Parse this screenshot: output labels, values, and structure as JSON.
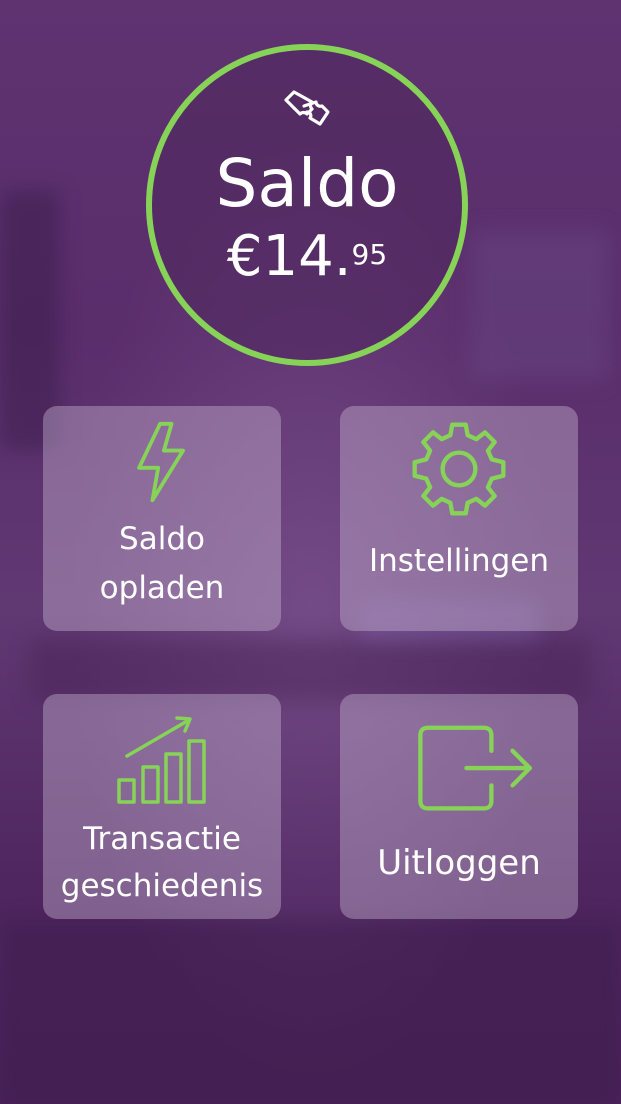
{
  "colors": {
    "accent": "#86d358",
    "background": "#5a2f6a",
    "text": "#ffffff"
  },
  "balance": {
    "icon": "ticket-icon",
    "title": "Saldo",
    "amount_main": "€14.",
    "amount_cents": "95"
  },
  "tiles": [
    {
      "icon": "lightning-bolt-icon",
      "line1": "Saldo",
      "line2": "opladen"
    },
    {
      "icon": "gear-icon",
      "label": "Instellingen"
    },
    {
      "icon": "growth-chart-icon",
      "line1": "Transactie",
      "line2": "geschiedenis"
    },
    {
      "icon": "logout-icon",
      "label": "Uitloggen"
    }
  ]
}
